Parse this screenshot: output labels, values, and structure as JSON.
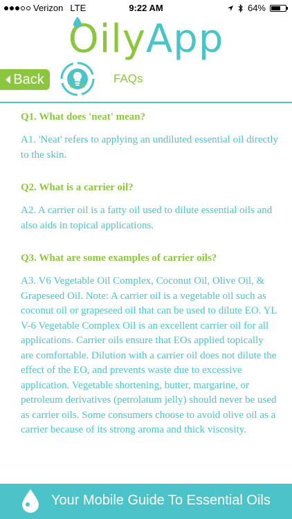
{
  "status_bar": {
    "carrier": "Verizon",
    "network": "LTE",
    "time": "9:22 AM",
    "battery": "64%",
    "battery_level": 0.64
  },
  "logo": {
    "part1": "Oily",
    "part2": "App"
  },
  "nav": {
    "back_label": "Back",
    "title": "FAQs"
  },
  "faqs": [
    {
      "question": "Q1. What does 'neat' mean?",
      "answer": "A1. 'Neat' refers to applying an undiluted essential oil directly to the skin."
    },
    {
      "question": "Q2. What is a carrier oil?",
      "answer": "A2. A carrier oil is a fatty oil used to dilute essential oils and also aids in topical applications."
    },
    {
      "question": "Q3. What are some examples of carrier oils?",
      "answer": "A3. V6 Vegetable Oil Complex, Coconut Oil, Olive Oil, & Grapeseed Oil. Note: A carrier oil is a vegetable oil such as coconut oil or grapeseed oil that can be used to dilute EO. YL V-6 Vegetable Complex Oil is an excellent carrier oil for all applications. Carrier oils ensure that EOs applied topically are comfortable. Dilution with a carrier oil does not dilute the effect of the EO, and prevents waste due to excessive application. Vegetable shortening, butter, margarine, or petroleum derivatives (petrolatum jelly) should never be used as carrier oils. Some consumers choose to avoid olive oil as a carrier because of its strong aroma and thick viscosity."
    }
  ],
  "footer": {
    "text": "Your Mobile Guide To Essential Oils"
  },
  "colors": {
    "green": "#8cc63f",
    "teal": "#4cc3c9"
  },
  "icons": [
    "location-arrow-icon",
    "bluetooth-icon",
    "battery-icon",
    "back-arrow-icon",
    "lightbulb-icon",
    "oil-drop-icon"
  ]
}
